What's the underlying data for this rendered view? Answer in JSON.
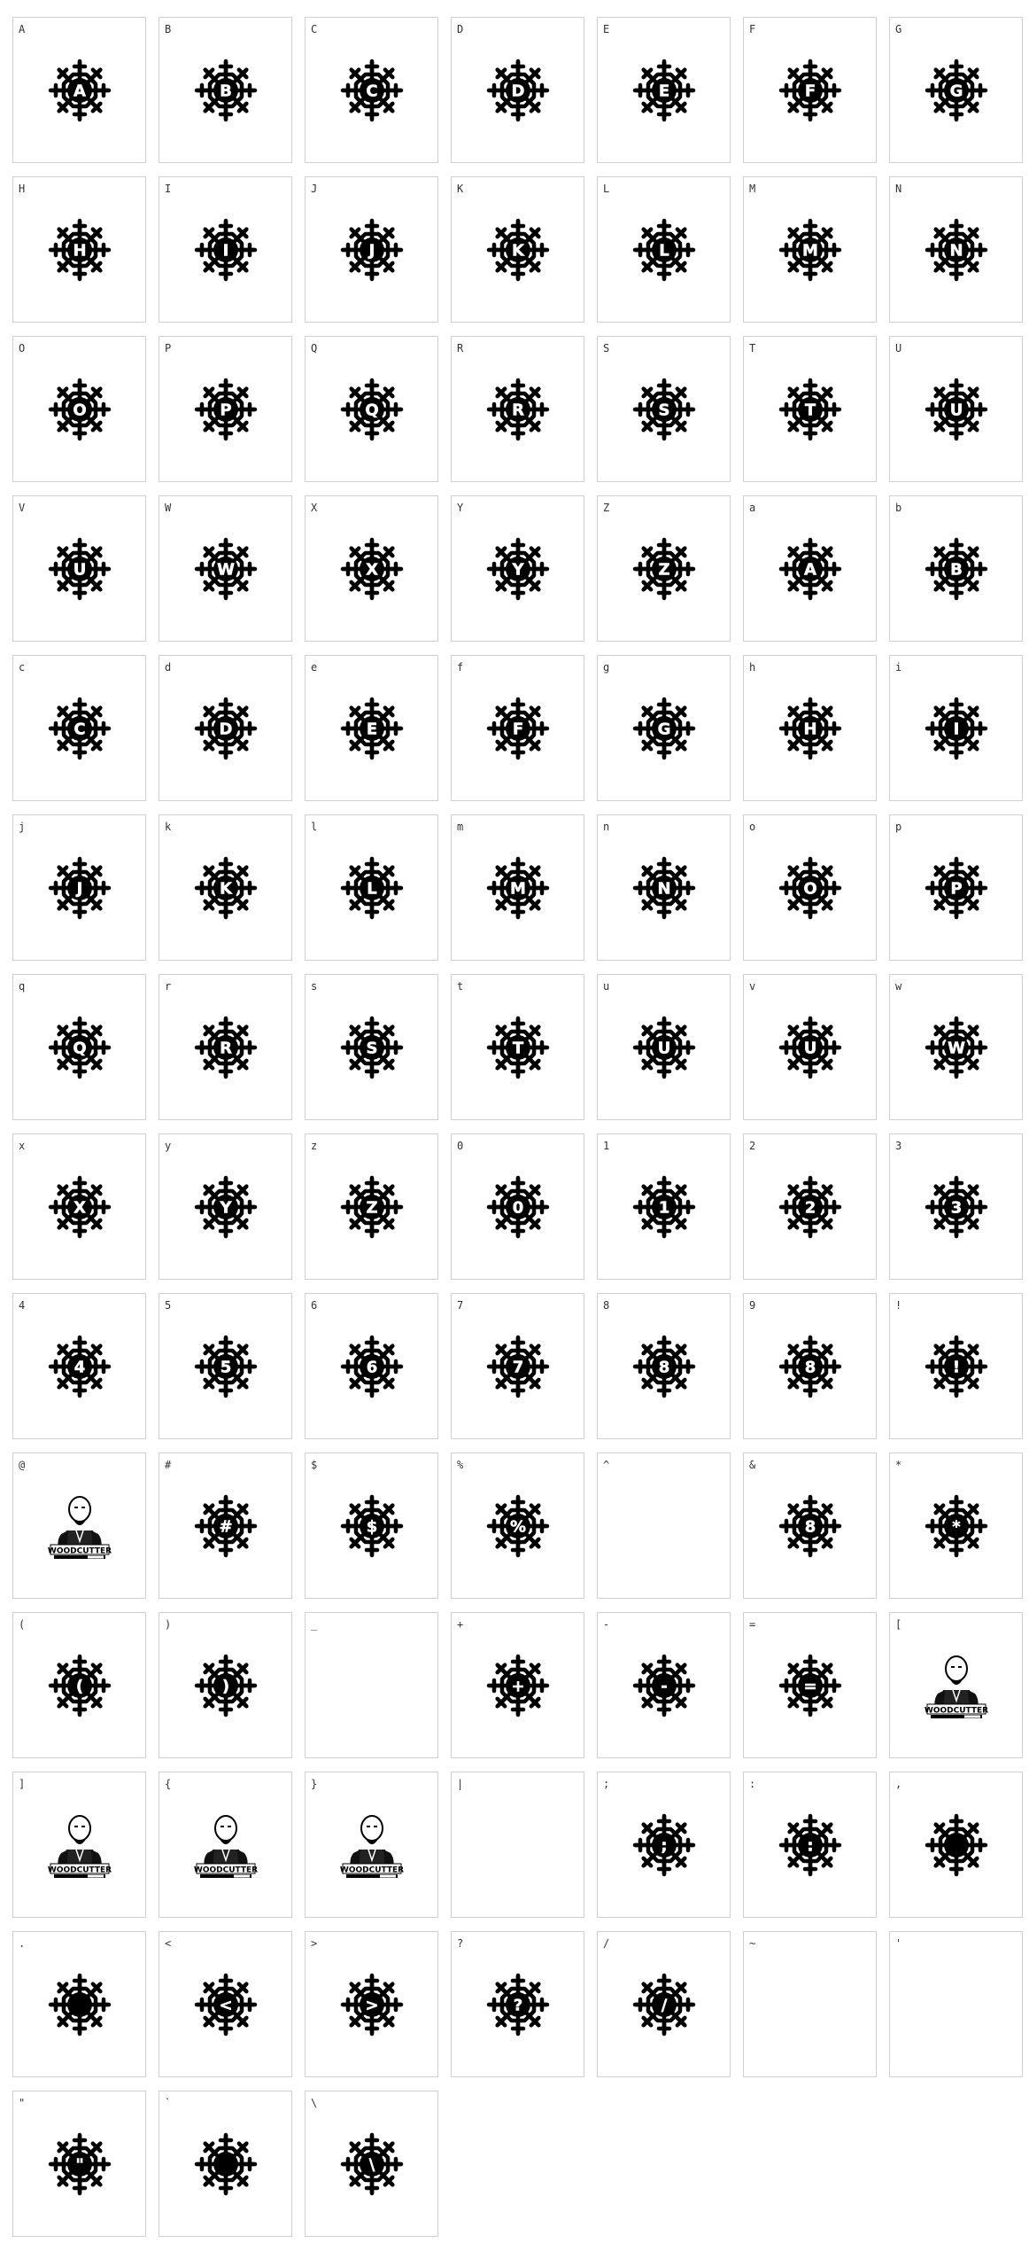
{
  "glyph_map": {
    "cells": [
      {
        "label": "A",
        "glyph": "A",
        "type": "flake"
      },
      {
        "label": "B",
        "glyph": "B",
        "type": "flake"
      },
      {
        "label": "C",
        "glyph": "C",
        "type": "flake"
      },
      {
        "label": "D",
        "glyph": "D",
        "type": "flake"
      },
      {
        "label": "E",
        "glyph": "E",
        "type": "flake"
      },
      {
        "label": "F",
        "glyph": "F",
        "type": "flake"
      },
      {
        "label": "G",
        "glyph": "G",
        "type": "flake"
      },
      {
        "label": "H",
        "glyph": "H",
        "type": "flake"
      },
      {
        "label": "I",
        "glyph": "I",
        "type": "flake"
      },
      {
        "label": "J",
        "glyph": "J",
        "type": "flake"
      },
      {
        "label": "K",
        "glyph": "K",
        "type": "flake"
      },
      {
        "label": "L",
        "glyph": "L",
        "type": "flake"
      },
      {
        "label": "M",
        "glyph": "M",
        "type": "flake"
      },
      {
        "label": "N",
        "glyph": "N",
        "type": "flake"
      },
      {
        "label": "O",
        "glyph": "O",
        "type": "flake"
      },
      {
        "label": "P",
        "glyph": "P",
        "type": "flake"
      },
      {
        "label": "Q",
        "glyph": "Q",
        "type": "flake"
      },
      {
        "label": "R",
        "glyph": "R",
        "type": "flake"
      },
      {
        "label": "S",
        "glyph": "S",
        "type": "flake"
      },
      {
        "label": "T",
        "glyph": "T",
        "type": "flake"
      },
      {
        "label": "U",
        "glyph": "U",
        "type": "flake"
      },
      {
        "label": "V",
        "glyph": "U",
        "type": "flake"
      },
      {
        "label": "W",
        "glyph": "W",
        "type": "flake"
      },
      {
        "label": "X",
        "glyph": "X",
        "type": "flake"
      },
      {
        "label": "Y",
        "glyph": "Y",
        "type": "flake"
      },
      {
        "label": "Z",
        "glyph": "Z",
        "type": "flake"
      },
      {
        "label": "a",
        "glyph": "A",
        "type": "flake"
      },
      {
        "label": "b",
        "glyph": "B",
        "type": "flake"
      },
      {
        "label": "c",
        "glyph": "C",
        "type": "flake"
      },
      {
        "label": "d",
        "glyph": "D",
        "type": "flake"
      },
      {
        "label": "e",
        "glyph": "E",
        "type": "flake"
      },
      {
        "label": "f",
        "glyph": "F",
        "type": "flake"
      },
      {
        "label": "g",
        "glyph": "G",
        "type": "flake"
      },
      {
        "label": "h",
        "glyph": "H",
        "type": "flake"
      },
      {
        "label": "i",
        "glyph": "I",
        "type": "flake"
      },
      {
        "label": "j",
        "glyph": "J",
        "type": "flake"
      },
      {
        "label": "k",
        "glyph": "K",
        "type": "flake"
      },
      {
        "label": "l",
        "glyph": "L",
        "type": "flake"
      },
      {
        "label": "m",
        "glyph": "M",
        "type": "flake"
      },
      {
        "label": "n",
        "glyph": "N",
        "type": "flake"
      },
      {
        "label": "o",
        "glyph": "O",
        "type": "flake"
      },
      {
        "label": "p",
        "glyph": "P",
        "type": "flake"
      },
      {
        "label": "q",
        "glyph": "Q",
        "type": "flake"
      },
      {
        "label": "r",
        "glyph": "R",
        "type": "flake"
      },
      {
        "label": "s",
        "glyph": "S",
        "type": "flake"
      },
      {
        "label": "t",
        "glyph": "T",
        "type": "flake"
      },
      {
        "label": "u",
        "glyph": "U",
        "type": "flake"
      },
      {
        "label": "v",
        "glyph": "U",
        "type": "flake"
      },
      {
        "label": "w",
        "glyph": "W",
        "type": "flake"
      },
      {
        "label": "x",
        "glyph": "X",
        "type": "flake"
      },
      {
        "label": "y",
        "glyph": "Y",
        "type": "flake"
      },
      {
        "label": "z",
        "glyph": "Z",
        "type": "flake"
      },
      {
        "label": "0",
        "glyph": "0",
        "type": "flake"
      },
      {
        "label": "1",
        "glyph": "1",
        "type": "flake"
      },
      {
        "label": "2",
        "glyph": "2",
        "type": "flake"
      },
      {
        "label": "3",
        "glyph": "3",
        "type": "flake"
      },
      {
        "label": "4",
        "glyph": "4",
        "type": "flake"
      },
      {
        "label": "5",
        "glyph": "5",
        "type": "flake"
      },
      {
        "label": "6",
        "glyph": "6",
        "type": "flake"
      },
      {
        "label": "7",
        "glyph": "7",
        "type": "flake"
      },
      {
        "label": "8",
        "glyph": "8",
        "type": "flake"
      },
      {
        "label": "9",
        "glyph": "8",
        "type": "flake"
      },
      {
        "label": "!",
        "glyph": "!",
        "type": "flake"
      },
      {
        "label": "@",
        "glyph": "WOODCUTTER",
        "type": "portrait"
      },
      {
        "label": "#",
        "glyph": "#",
        "type": "flake"
      },
      {
        "label": "$",
        "glyph": "$",
        "type": "flake"
      },
      {
        "label": "%",
        "glyph": "%",
        "type": "flake"
      },
      {
        "label": "^",
        "glyph": "",
        "type": "empty"
      },
      {
        "label": "&",
        "glyph": "8",
        "type": "flake"
      },
      {
        "label": "*",
        "glyph": "*",
        "type": "flake"
      },
      {
        "label": "(",
        "glyph": "(",
        "type": "flake"
      },
      {
        "label": ")",
        "glyph": ")",
        "type": "flake"
      },
      {
        "label": "_",
        "glyph": "",
        "type": "empty"
      },
      {
        "label": "+",
        "glyph": "+",
        "type": "flake"
      },
      {
        "label": "-",
        "glyph": "-",
        "type": "flake"
      },
      {
        "label": "=",
        "glyph": "=",
        "type": "flake"
      },
      {
        "label": "[",
        "glyph": "WOODCUTTER",
        "type": "portrait"
      },
      {
        "label": "]",
        "glyph": "WOODCUTTER",
        "type": "portrait"
      },
      {
        "label": "{",
        "glyph": "WOODCUTTER",
        "type": "portrait"
      },
      {
        "label": "}",
        "glyph": "WOODCUTTER",
        "type": "portrait"
      },
      {
        "label": "|",
        "glyph": "",
        "type": "empty"
      },
      {
        "label": ";",
        "glyph": ";",
        "type": "flake"
      },
      {
        "label": ":",
        "glyph": ":",
        "type": "flake"
      },
      {
        "label": ",",
        "glyph": "",
        "type": "flake"
      },
      {
        "label": ".",
        "glyph": "",
        "type": "flake"
      },
      {
        "label": "<",
        "glyph": "<",
        "type": "flake"
      },
      {
        "label": ">",
        "glyph": ">",
        "type": "flake"
      },
      {
        "label": "?",
        "glyph": "?",
        "type": "flake"
      },
      {
        "label": "/",
        "glyph": "/",
        "type": "flake"
      },
      {
        "label": "~",
        "glyph": "",
        "type": "empty"
      },
      {
        "label": "'",
        "glyph": "",
        "type": "empty"
      },
      {
        "label": "\"",
        "glyph": "\"",
        "type": "flake"
      },
      {
        "label": "`",
        "glyph": "",
        "type": "flake"
      },
      {
        "label": "\\",
        "glyph": "\\",
        "type": "flake"
      }
    ]
  }
}
